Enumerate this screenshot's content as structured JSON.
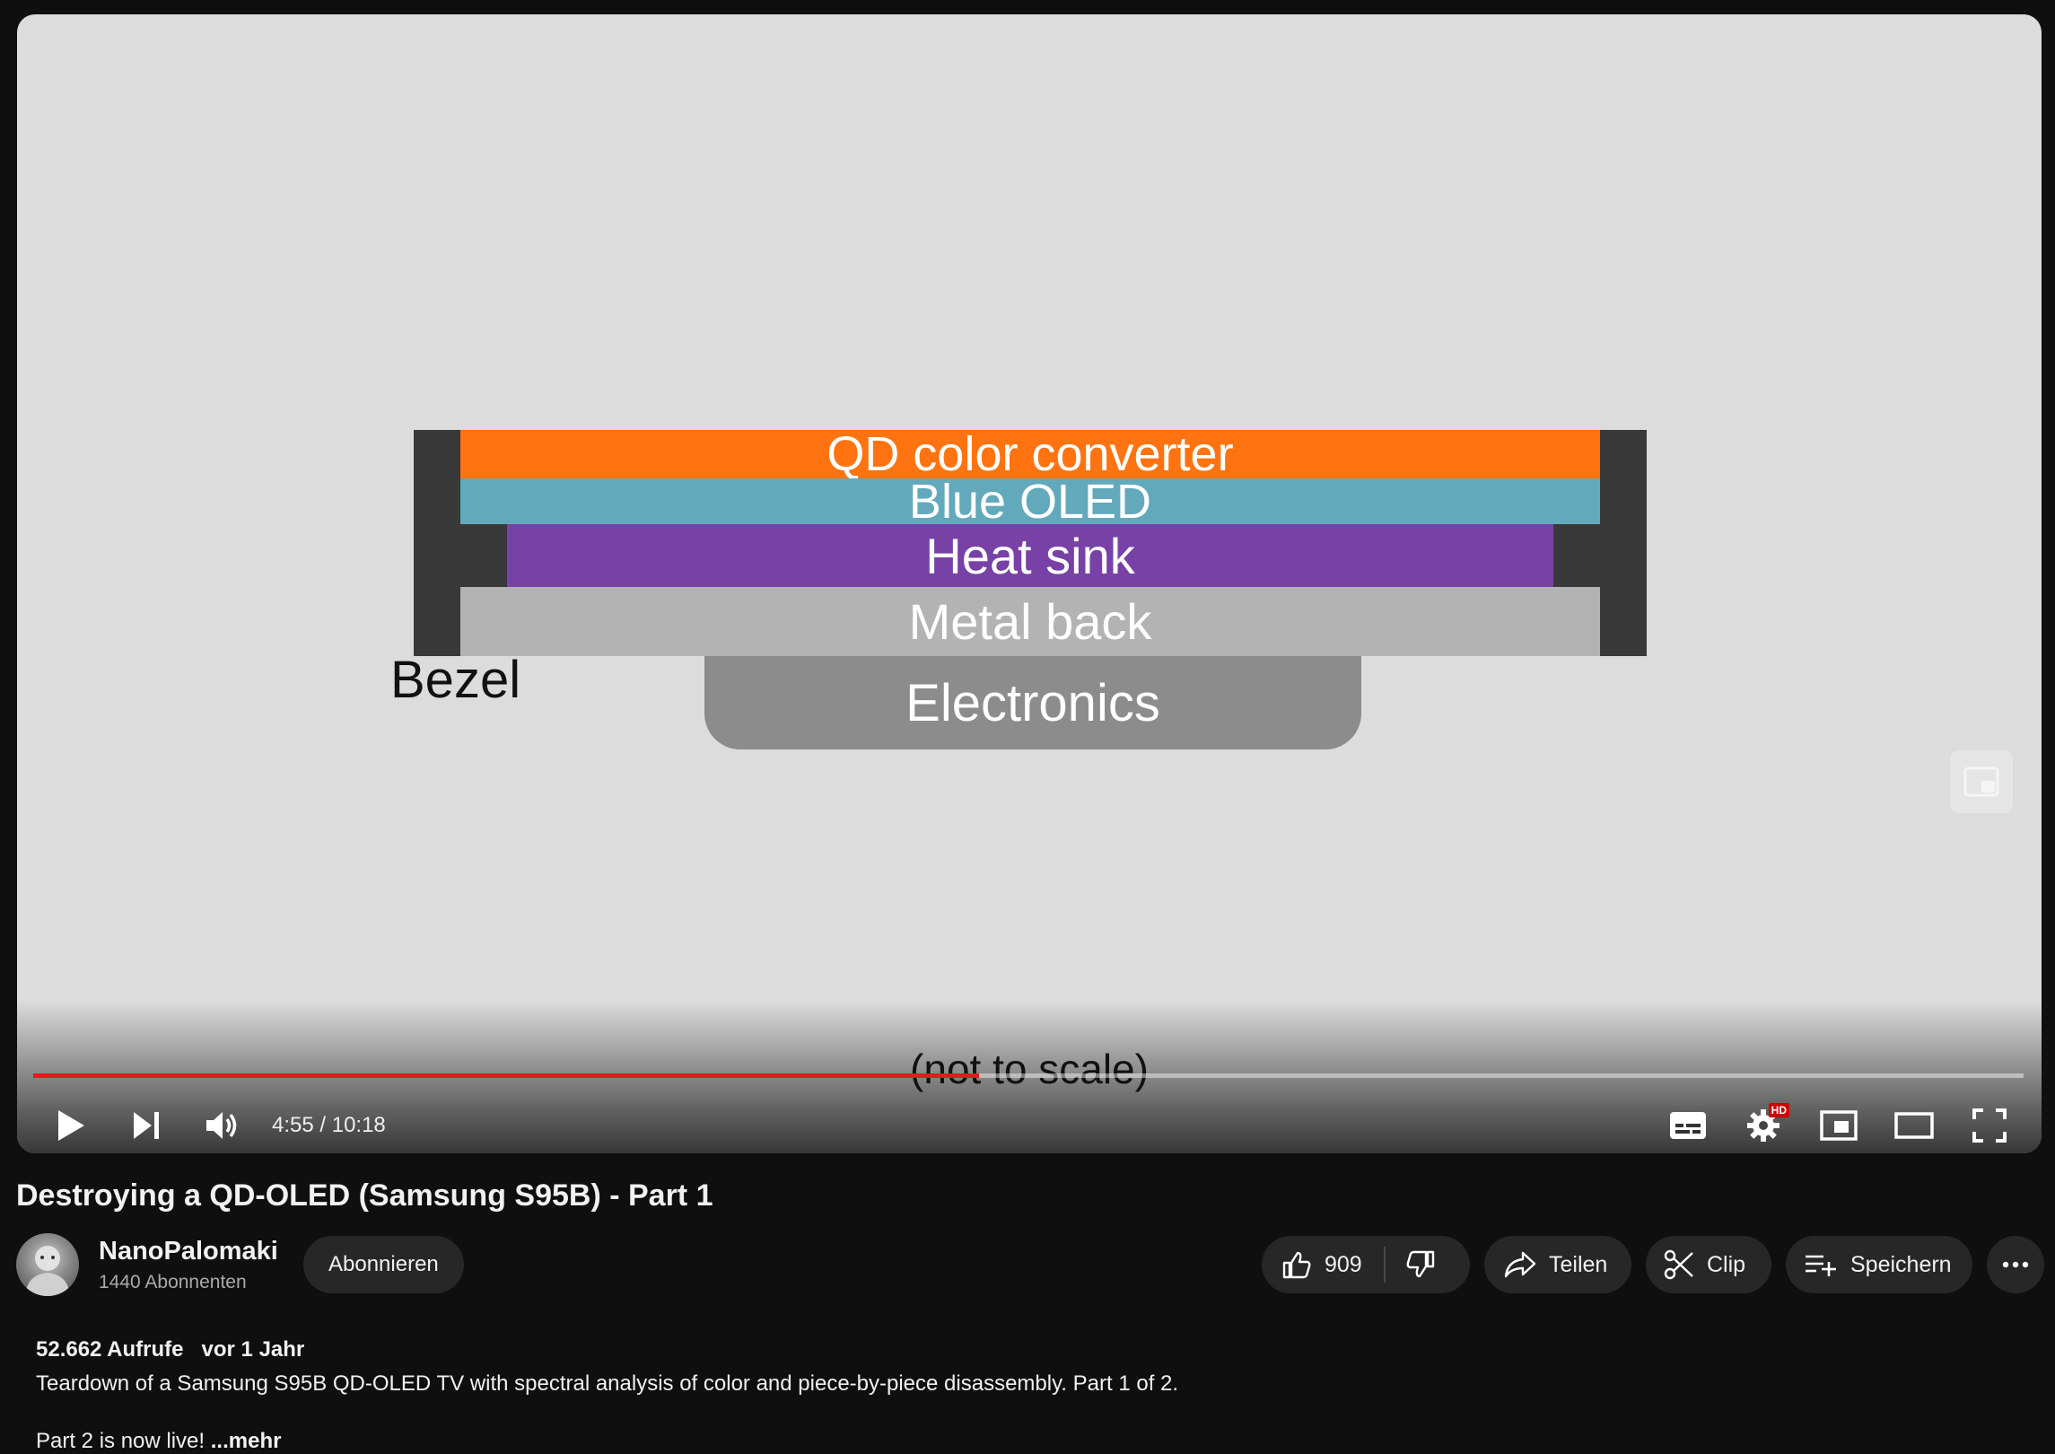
{
  "video": {
    "diagram": {
      "layers": [
        "QD color converter",
        "Blue OLED",
        "Heat sink",
        "Metal back"
      ],
      "colors": {
        "qd_color_converter": "#ff7410",
        "blue_oled": "#63a9bc",
        "heat_sink": "#7741a6",
        "metal_back": "#b3b3b3",
        "bezel": "#393939",
        "electronics": "#8c8c8c"
      },
      "bezel_label": "Bezel",
      "electronics_label": "Electronics",
      "caption": "(not to scale)"
    },
    "progress_fraction": 0.475,
    "time": "4:55 / 10:18",
    "accent_color": "#e01c1c",
    "hd_badge": "HD",
    "icons": [
      "play-icon",
      "next-icon",
      "volume-icon",
      "subtitles-icon",
      "settings-icon",
      "miniplayer-icon",
      "theater-mode-icon",
      "fullscreen-icon"
    ]
  },
  "title": "Destroying a QD-OLED (Samsung S95B) - Part 1",
  "channel": {
    "name": "NanoPalomaki",
    "subscribers": "1440 Abonnenten",
    "subscribe_label": "Abonnieren"
  },
  "actions": {
    "likes": "909",
    "share_label": "Teilen",
    "clip_label": "Clip",
    "save_label": "Speichern"
  },
  "description": {
    "views": "52.662 Aufrufe",
    "age": "vor 1 Jahr",
    "line1": "Teardown of a Samsung S95B QD-OLED TV with spectral analysis of color and piece-by-piece disassembly. Part 1 of 2.",
    "line2": "Part 2 is now live!",
    "more": "...mehr"
  }
}
